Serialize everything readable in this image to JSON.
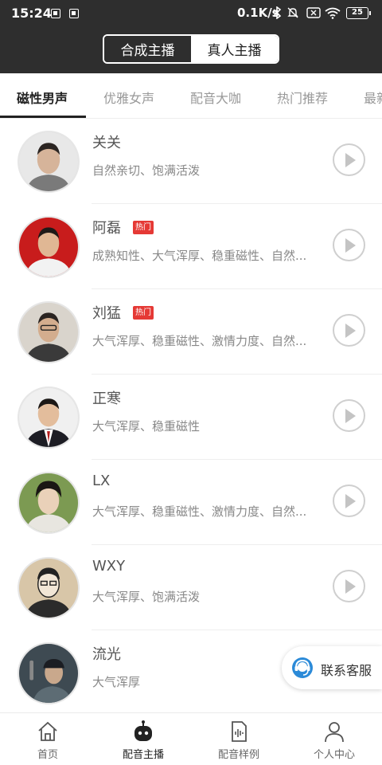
{
  "status_bar": {
    "time": "15:24",
    "network_speed": "0.1K/s",
    "battery": "25"
  },
  "mode_switch": {
    "options": [
      "合成主播",
      "真人主播"
    ],
    "selected": "真人主播"
  },
  "category_tabs": [
    "磁性男声",
    "优雅女声",
    "配音大咖",
    "热门推荐",
    "最新"
  ],
  "active_tab": "磁性男声",
  "anchors": [
    {
      "name": "关关",
      "hot": "",
      "desc": "自然亲切、饱满活泼"
    },
    {
      "name": "阿磊",
      "hot": "热门",
      "desc": "成熟知性、大气浑厚、稳重磁性、自然..."
    },
    {
      "name": "刘猛",
      "hot": "热门",
      "desc": "大气浑厚、稳重磁性、激情力度、自然..."
    },
    {
      "name": "正寒",
      "hot": "",
      "desc": "大气浑厚、稳重磁性"
    },
    {
      "name": "LX",
      "hot": "",
      "desc": "大气浑厚、稳重磁性、激情力度、自然..."
    },
    {
      "name": "WXY",
      "hot": "",
      "desc": "大气浑厚、饱满活泼"
    },
    {
      "name": "流光",
      "hot": "",
      "desc": "大气浑厚"
    }
  ],
  "support_button": {
    "label": "联系客服"
  },
  "bottom_nav": [
    {
      "label": "首页",
      "icon": "home-icon"
    },
    {
      "label": "配音主播",
      "icon": "robot-icon"
    },
    {
      "label": "配音样例",
      "icon": "audio-file-icon"
    },
    {
      "label": "个人中心",
      "icon": "person-icon"
    }
  ],
  "active_nav": "配音主播",
  "colors": {
    "header_bg": "#2e2e2e",
    "hot_badge": "#e53935",
    "support_icon": "#2b8ad8"
  }
}
